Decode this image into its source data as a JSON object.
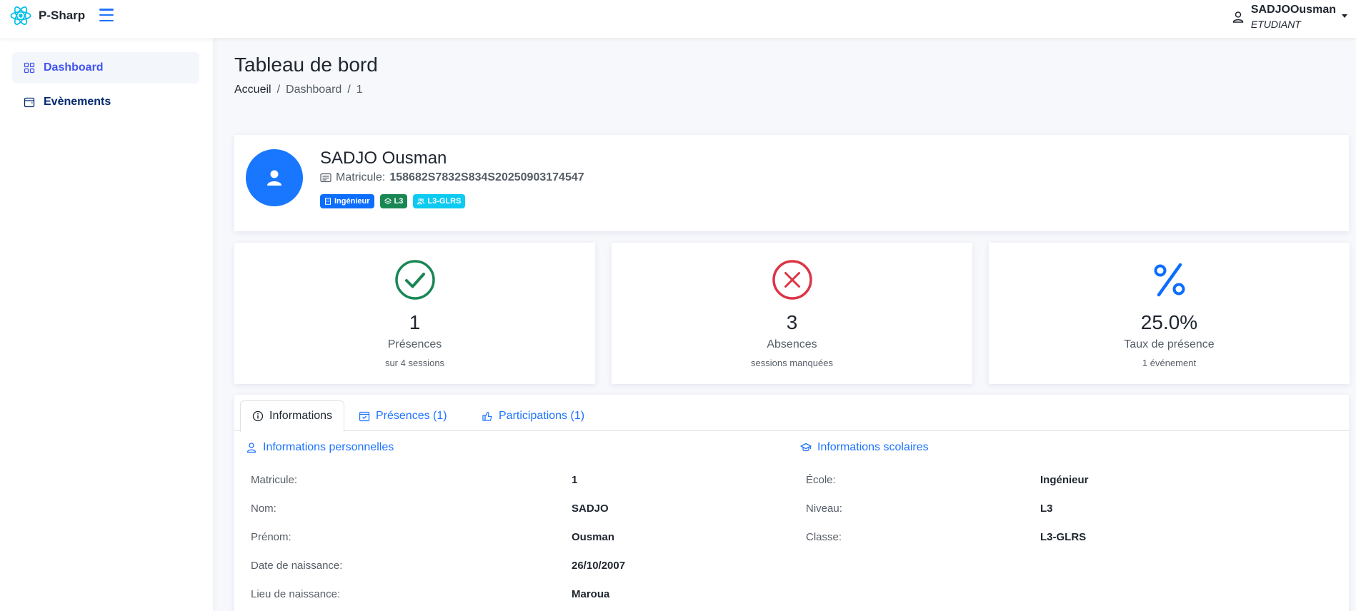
{
  "app": {
    "title": "P-Sharp",
    "logo_icon": "react-logo-icon",
    "menu_icon": "hamburger-icon"
  },
  "user": {
    "name": "SADJOOusman",
    "role": "ETUDIANT"
  },
  "sidebar": {
    "items": [
      {
        "label": "Dashboard",
        "icon": "grid-icon",
        "active": true
      },
      {
        "label": "Evènements",
        "icon": "calendar-icon",
        "active": false
      }
    ]
  },
  "page": {
    "title": "Tableau de bord",
    "breadcrumb": [
      "Accueil",
      "Dashboard",
      "1"
    ],
    "breadcrumb_separator": "/"
  },
  "profile": {
    "name": "SADJO Ousman",
    "matricule_label": "Matricule:",
    "matricule_value": "158682S7832S834S20250903174547",
    "badges": [
      {
        "label": "Ingénieur",
        "icon": "building-icon",
        "color": "#0d6efd"
      },
      {
        "label": "L3",
        "icon": "layers-icon",
        "color": "#198754"
      },
      {
        "label": "L3-GLRS",
        "icon": "people-icon",
        "color": "#0dcaf0"
      }
    ]
  },
  "stats": [
    {
      "icon": "check-circle-icon",
      "color": "#198754",
      "value": "1",
      "label": "Présences",
      "sub": "sur 4 sessions"
    },
    {
      "icon": "x-circle-icon",
      "color": "#dc3545",
      "value": "3",
      "label": "Absences",
      "sub": "sessions manquées"
    },
    {
      "icon": "percent-icon",
      "color": "#0d6efd",
      "value": "25.0%",
      "label": "Taux de présence",
      "sub": "1 événement"
    }
  ],
  "tabs": [
    {
      "label": "Informations",
      "icon": "info-circle-icon",
      "active": true
    },
    {
      "label": "Présences (1)",
      "icon": "calendar-check-icon",
      "active": false
    },
    {
      "label": "Participations (1)",
      "icon": "hand-thumbs-up-icon",
      "active": false
    }
  ],
  "personal": {
    "title": "Informations personnelles",
    "rows": [
      {
        "label": "Matricule:",
        "value": "1"
      },
      {
        "label": "Nom:",
        "value": "SADJO"
      },
      {
        "label": "Prénom:",
        "value": "Ousman"
      },
      {
        "label": "Date de naissance:",
        "value": "26/10/2007"
      },
      {
        "label": "Lieu de naissance:",
        "value": "Maroua"
      }
    ]
  },
  "school": {
    "title": "Informations scolaires",
    "rows": [
      {
        "label": "École:",
        "value": "Ingénieur"
      },
      {
        "label": "Niveau:",
        "value": "L3"
      },
      {
        "label": "Classe:",
        "value": "L3-GLRS"
      }
    ]
  }
}
